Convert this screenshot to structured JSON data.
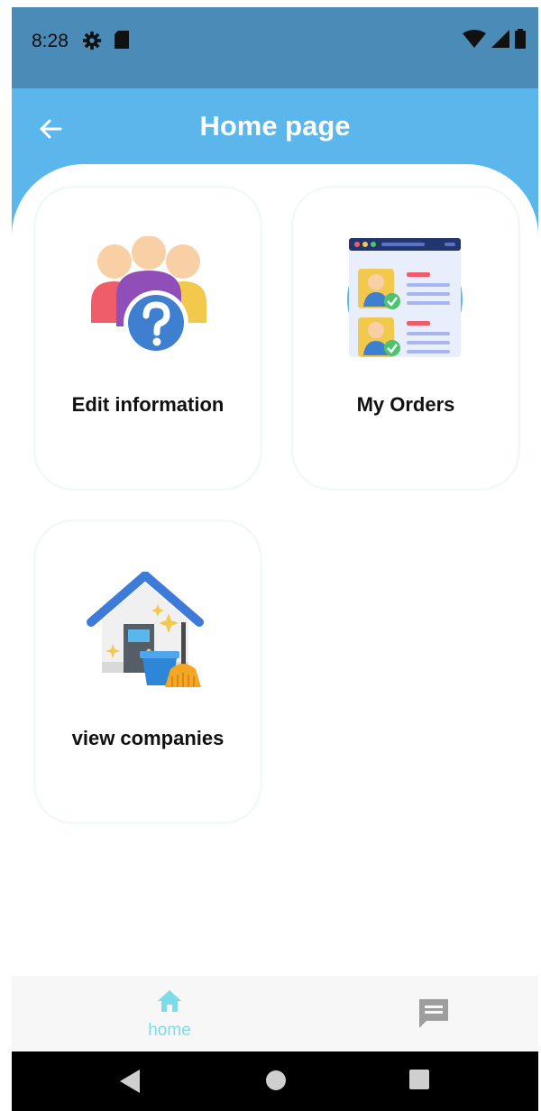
{
  "status_bar": {
    "time": "8:28",
    "icons": [
      "gear-icon",
      "sd-card-icon",
      "wifi-icon",
      "cell-signal-icon",
      "battery-icon"
    ]
  },
  "app_bar": {
    "title": "Home page",
    "back_icon": "arrow-left-icon",
    "color": "#5bb6ec"
  },
  "cards": [
    {
      "label": "Edit information",
      "icon": "group-question-icon"
    },
    {
      "label": "My Orders",
      "icon": "orders-profiles-icon"
    },
    {
      "label": "view companies",
      "icon": "house-cleaning-icon"
    }
  ],
  "bottom_nav": {
    "items": [
      {
        "label": "home",
        "icon": "home-icon",
        "active": true,
        "color": "#7cdde8"
      },
      {
        "label": "",
        "icon": "chat-icon",
        "active": false,
        "color": "#9e9e9e"
      }
    ]
  },
  "system_nav": [
    "back-triangle-icon",
    "home-circle-icon",
    "recents-square-icon"
  ]
}
